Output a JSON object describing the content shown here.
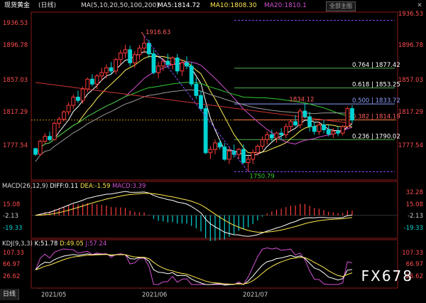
{
  "header": {
    "symbol": "现货黄金",
    "period": "日线",
    "ma_label": "MA(5,10,20,50,100,200)",
    "ma5": "MA5:1814.72",
    "ma10": "MA10:1808.30",
    "ma20": "MA20:1810.1",
    "main_button": "全部主图",
    "close_icon": "close-icon"
  },
  "axis": {
    "price_ticks": [
      "1936.53",
      "1896.78",
      "1857.03",
      "1817.29",
      "1777.54"
    ],
    "macd_ticks": [
      "32.28",
      "15.08",
      "-2.13",
      "-19.33"
    ],
    "kdj_ticks": [
      "107.33",
      "66.97",
      "26.62"
    ]
  },
  "annotations": {
    "high": "1916.63",
    "low": "1750.79",
    "local_high": "1834.12",
    "fib": [
      {
        "label": "0.764 | 1877.42",
        "color": "#ffffff"
      },
      {
        "label": "0.618 | 1853.25",
        "color": "#ffffff"
      },
      {
        "label": "0.500 | 1833.72",
        "color": "#8fa0ff"
      },
      {
        "label": "0.382 | 1814.19",
        "color": "#ff5c5c"
      },
      {
        "label": "0.236 | 1790.02",
        "color": "#ffffff"
      }
    ]
  },
  "macd": {
    "label": "MACD(26,12,9)",
    "diff": "DIFF:0.11",
    "dea": "DEA:-1.59",
    "macd": "MACD:3.39"
  },
  "kdj": {
    "label": "KDJ(9,3,3)",
    "k": "K:51.78",
    "d": "D:49.05",
    "j": "J:57.24"
  },
  "footer": {
    "period_button": "日线",
    "dates": [
      "2021/05",
      "2021/06",
      "2021/07"
    ]
  },
  "watermark": "FX678",
  "colors": {
    "up": "#ff3b3b",
    "down": "#00d3d3",
    "ma5": "#ffffff",
    "ma10": "#ffee55",
    "ma20": "#d34fd3",
    "ma50": "#33cc33",
    "ma100": "#999999",
    "ma200": "#cc3333"
  },
  "chart_data": {
    "type": "candlestick",
    "price_range": [
      1745,
      1940
    ],
    "ohlc": [
      [
        1779,
        1780,
        1770,
        1772
      ],
      [
        1772,
        1790,
        1770,
        1788
      ],
      [
        1788,
        1798,
        1785,
        1794
      ],
      [
        1794,
        1800,
        1788,
        1790
      ],
      [
        1790,
        1812,
        1789,
        1810
      ],
      [
        1810,
        1818,
        1804,
        1815
      ],
      [
        1815,
        1826,
        1812,
        1824
      ],
      [
        1824,
        1836,
        1820,
        1832
      ],
      [
        1832,
        1845,
        1828,
        1842
      ],
      [
        1842,
        1850,
        1835,
        1838
      ],
      [
        1838,
        1855,
        1834,
        1852
      ],
      [
        1852,
        1866,
        1848,
        1864
      ],
      [
        1864,
        1870,
        1855,
        1858
      ],
      [
        1858,
        1870,
        1852,
        1868
      ],
      [
        1868,
        1878,
        1862,
        1872
      ],
      [
        1872,
        1882,
        1865,
        1878
      ],
      [
        1878,
        1885,
        1870,
        1874
      ],
      [
        1874,
        1890,
        1870,
        1888
      ],
      [
        1888,
        1900,
        1882,
        1896
      ],
      [
        1896,
        1906,
        1890,
        1900
      ],
      [
        1900,
        1905,
        1880,
        1884
      ],
      [
        1884,
        1898,
        1878,
        1894
      ],
      [
        1894,
        1906,
        1888,
        1902
      ],
      [
        1902,
        1916.63,
        1896,
        1908
      ],
      [
        1908,
        1912,
        1890,
        1895
      ],
      [
        1895,
        1900,
        1870,
        1872
      ],
      [
        1872,
        1885,
        1865,
        1880
      ],
      [
        1880,
        1890,
        1874,
        1886
      ],
      [
        1886,
        1895,
        1878,
        1882
      ],
      [
        1882,
        1892,
        1876,
        1890
      ],
      [
        1890,
        1895,
        1870,
        1874
      ],
      [
        1874,
        1888,
        1868,
        1884
      ],
      [
        1884,
        1892,
        1876,
        1880
      ],
      [
        1880,
        1884,
        1855,
        1858
      ],
      [
        1858,
        1866,
        1840,
        1844
      ],
      [
        1844,
        1850,
        1825,
        1828
      ],
      [
        1828,
        1832,
        1772,
        1774
      ],
      [
        1774,
        1782,
        1766,
        1778
      ],
      [
        1778,
        1790,
        1772,
        1786
      ],
      [
        1786,
        1790,
        1778,
        1781
      ],
      [
        1781,
        1786,
        1764,
        1766
      ],
      [
        1766,
        1780,
        1760,
        1776
      ],
      [
        1776,
        1784,
        1768,
        1772
      ],
      [
        1772,
        1780,
        1766,
        1778
      ],
      [
        1778,
        1784,
        1760,
        1762
      ],
      [
        1762,
        1770,
        1750.79,
        1766
      ],
      [
        1766,
        1778,
        1760,
        1774
      ],
      [
        1774,
        1784,
        1770,
        1782
      ],
      [
        1782,
        1794,
        1778,
        1790
      ],
      [
        1790,
        1800,
        1784,
        1796
      ],
      [
        1796,
        1802,
        1788,
        1792
      ],
      [
        1792,
        1800,
        1786,
        1798
      ],
      [
        1798,
        1804,
        1790,
        1796
      ],
      [
        1796,
        1810,
        1792,
        1806
      ],
      [
        1806,
        1814,
        1800,
        1812
      ],
      [
        1812,
        1820,
        1806,
        1808
      ],
      [
        1808,
        1828,
        1804,
        1825
      ],
      [
        1825,
        1834.12,
        1816,
        1818
      ],
      [
        1818,
        1824,
        1800,
        1806
      ],
      [
        1806,
        1812,
        1796,
        1800
      ],
      [
        1800,
        1812,
        1796,
        1808
      ],
      [
        1808,
        1814,
        1798,
        1802
      ],
      [
        1802,
        1808,
        1794,
        1797
      ],
      [
        1797,
        1804,
        1792,
        1800
      ],
      [
        1800,
        1806,
        1794,
        1798
      ],
      [
        1798,
        1808,
        1795,
        1806
      ],
      [
        1806,
        1830,
        1804,
        1828
      ],
      [
        1828,
        1832,
        1810,
        1814
      ]
    ],
    "fib_levels": [
      {
        "ratio": 0.764,
        "price": 1877.42
      },
      {
        "ratio": 0.618,
        "price": 1853.25
      },
      {
        "ratio": 0.5,
        "price": 1833.72
      },
      {
        "ratio": 0.382,
        "price": 1814.19
      },
      {
        "ratio": 0.236,
        "price": 1790.02
      }
    ],
    "xlabels": [
      "2021/05",
      "2021/06",
      "2021/07"
    ]
  }
}
